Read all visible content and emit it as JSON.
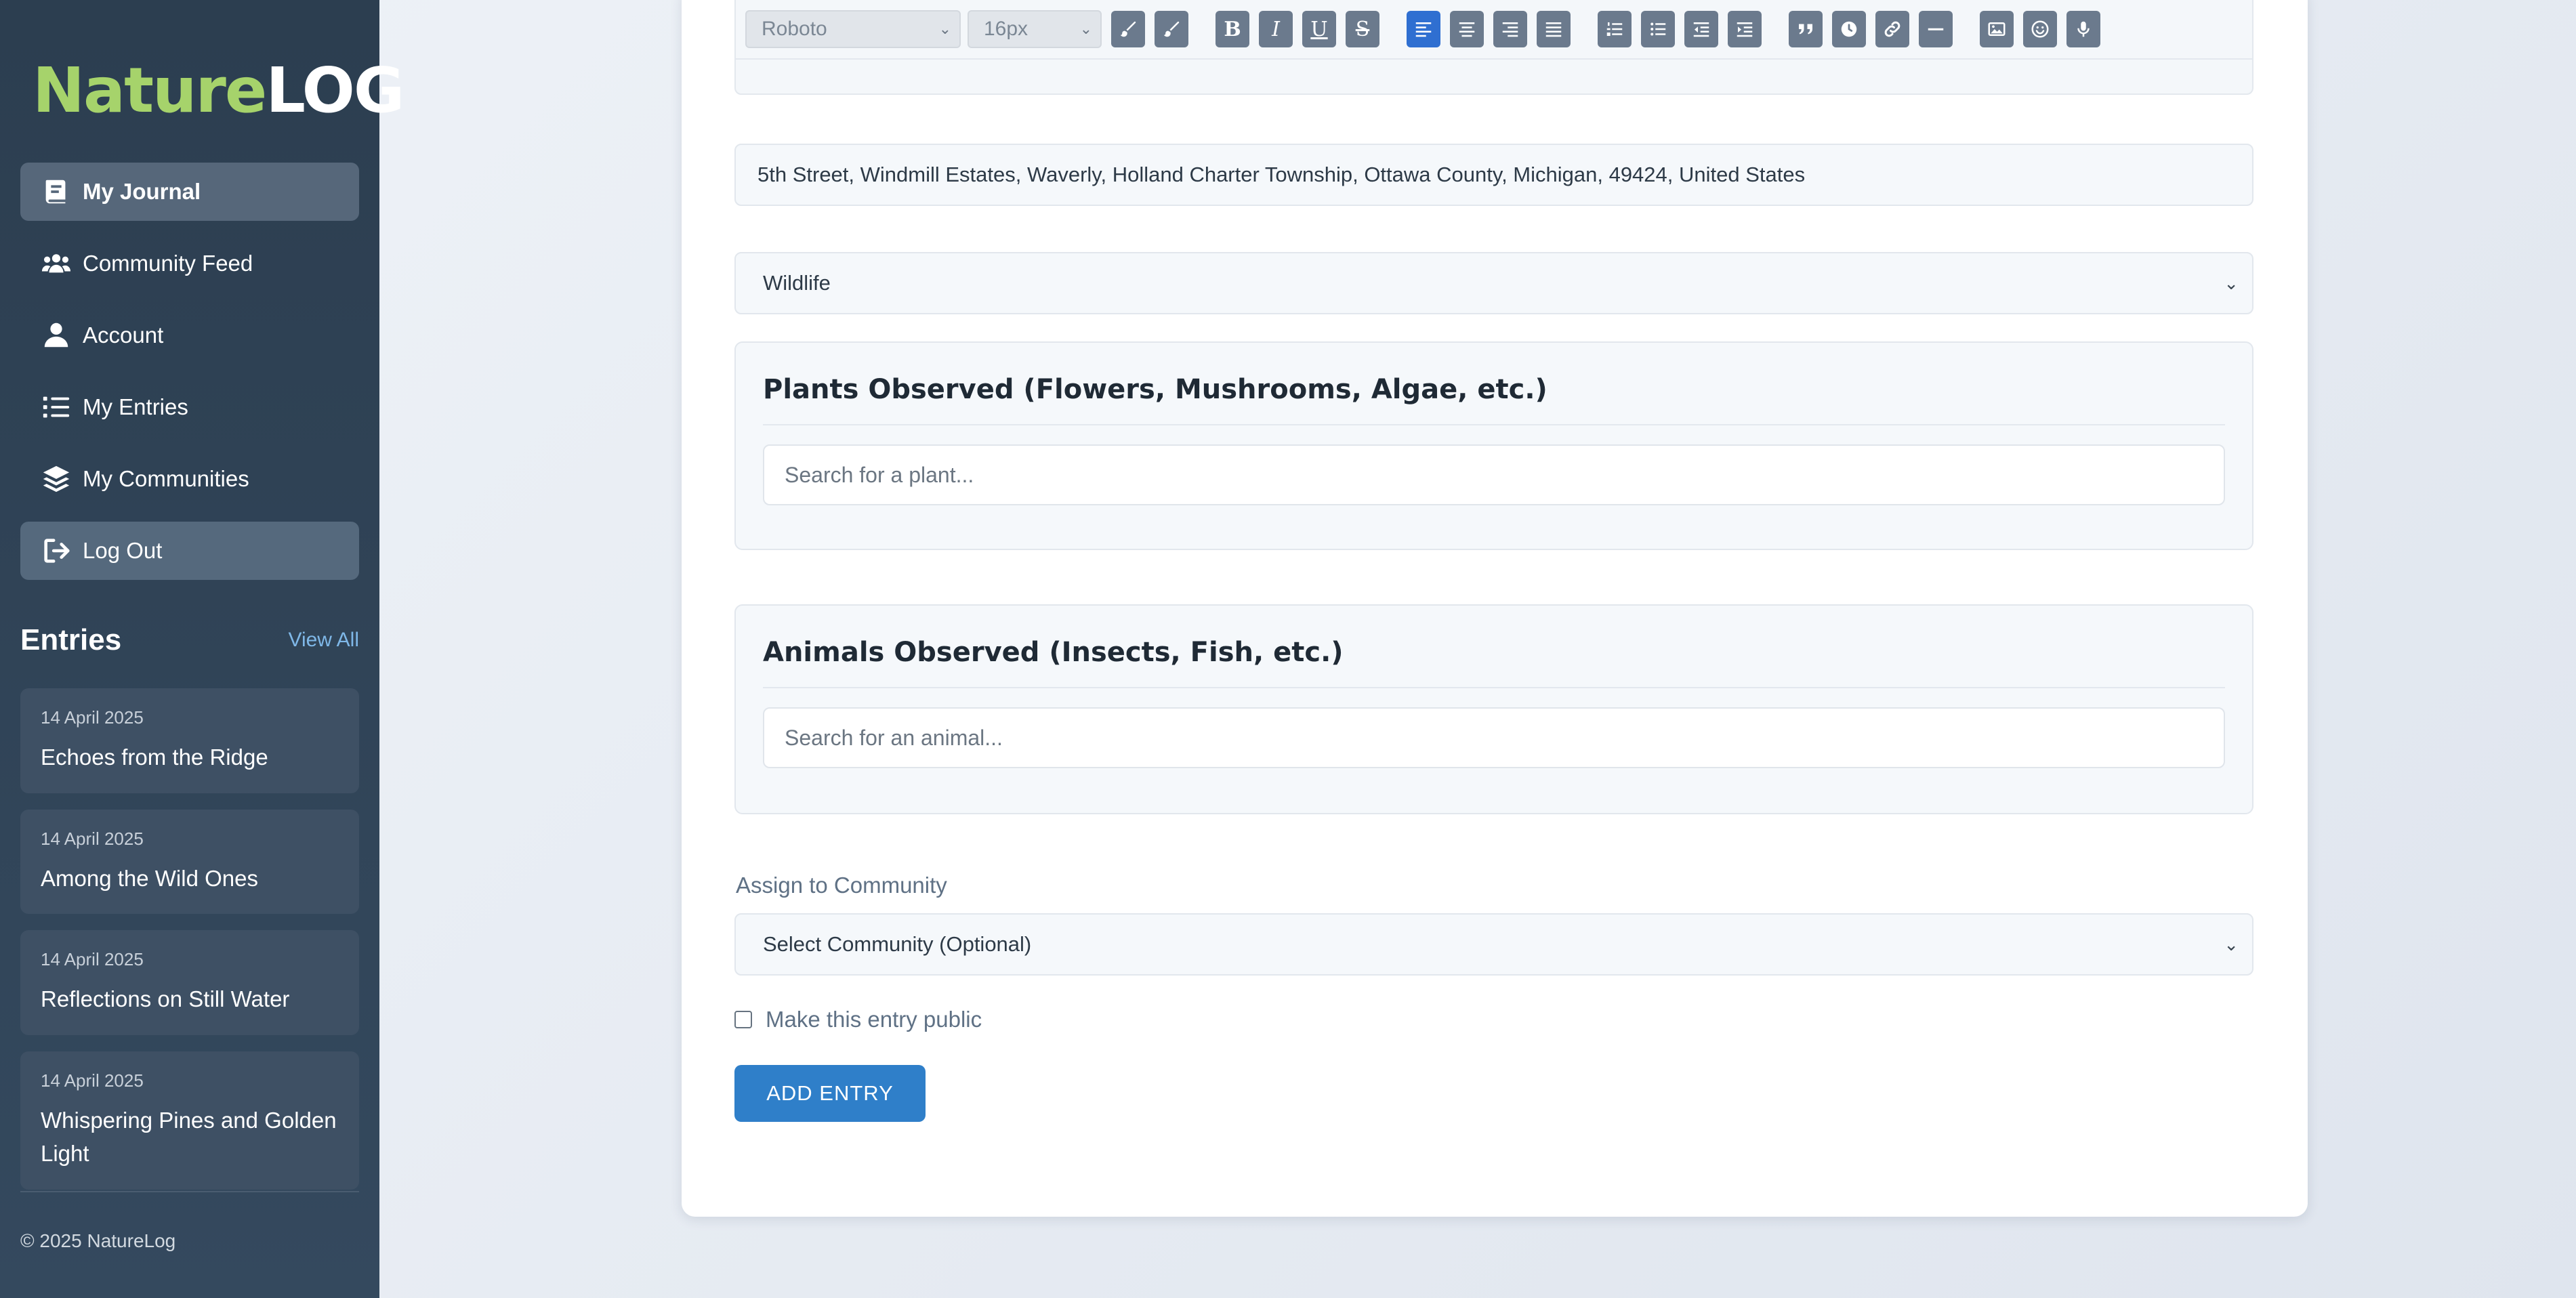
{
  "brand": {
    "part1": "Nature",
    "part2": "LOG"
  },
  "nav": [
    {
      "label": "My Journal",
      "icon": "book-icon"
    },
    {
      "label": "Community Feed",
      "icon": "users-icon"
    },
    {
      "label": "Account",
      "icon": "user-icon"
    },
    {
      "label": "My Entries",
      "icon": "list-icon"
    },
    {
      "label": "My Communities",
      "icon": "layers-icon"
    },
    {
      "label": "Log Out",
      "icon": "logout-icon"
    }
  ],
  "entries_section": {
    "title": "Entries",
    "view_all": "View All",
    "items": [
      {
        "date": "14 April 2025",
        "title": "Echoes from the Ridge"
      },
      {
        "date": "14 April 2025",
        "title": "Among the Wild Ones"
      },
      {
        "date": "14 April 2025",
        "title": "Reflections on Still Water"
      },
      {
        "date": "14 April 2025",
        "title": "Whispering Pines and Golden Light"
      }
    ]
  },
  "footer": {
    "copyright": "© 2025 NatureLog"
  },
  "editor": {
    "font_family": "Roboto",
    "font_size": "16px",
    "buttons": {
      "bold": "B",
      "italic": "I",
      "underline": "U",
      "strike": "S"
    }
  },
  "form": {
    "location": "5th Street, Windmill Estates, Waverly, Holland Charter Township, Ottawa County, Michigan, 49424, United States",
    "category": "Wildlife",
    "plants": {
      "title": "Plants Observed (Flowers, Mushrooms, Algae, etc.)",
      "placeholder": "Search for a plant..."
    },
    "animals": {
      "title": "Animals Observed (Insects, Fish, etc.)",
      "placeholder": "Search for an animal..."
    },
    "community_label": "Assign to Community",
    "community_value": "Select Community (Optional)",
    "public_label": "Make this entry public",
    "public_checked": false,
    "submit_label": "ADD ENTRY"
  },
  "colors": {
    "sidebar": "#2c3e50",
    "accent": "#2f7fc9",
    "logo_green": "#a6d36b",
    "toolbar_active": "#2f6fd1"
  }
}
